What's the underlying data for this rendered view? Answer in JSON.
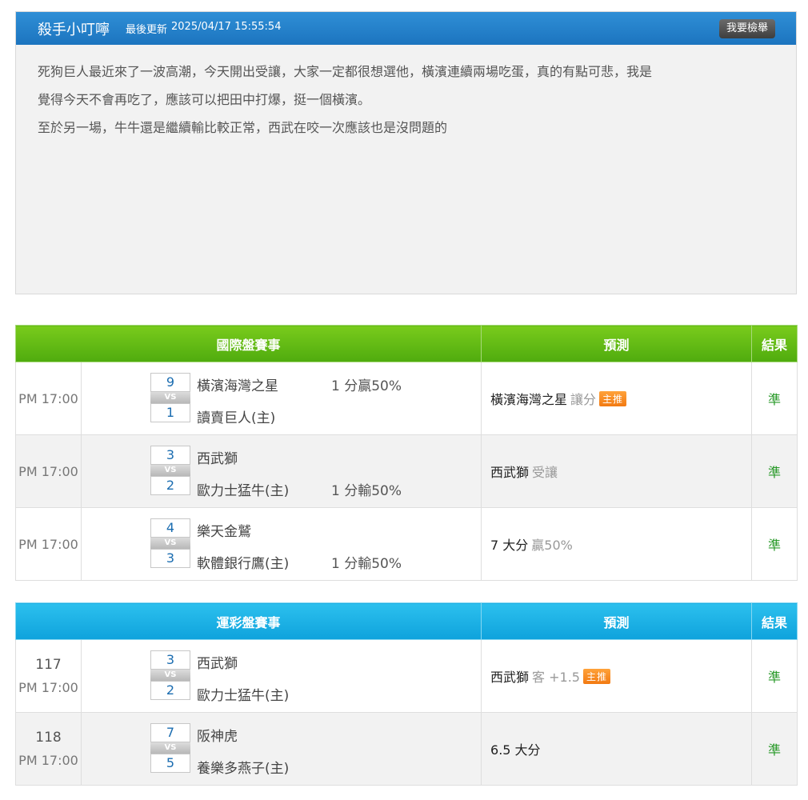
{
  "post": {
    "author": "殺手小叮嚀",
    "updated_label": "最後更新",
    "updated_time": "2025/04/17 15:55:54",
    "report_button": "我要檢舉",
    "body_lines": [
      "死狗巨人最近來了一波高潮，今天開出受讓，大家一定都很想選他，橫濱連續兩場吃蛋，真的有點可悲，我是",
      "覺得今天不會再吃了，應該可以把田中打爆，挺一個橫濱。",
      "至於另一場，牛牛還是繼續輸比較正常，西武在咬一次應該也是沒問題的"
    ]
  },
  "intl": {
    "header_match": "國際盤賽事",
    "header_pred": "預測",
    "header_result": "結果",
    "rows": [
      {
        "time": "PM 17:00",
        "score1": "9",
        "vs": "VS",
        "score2": "1",
        "team1": "橫濱海灣之星",
        "team2": "讀賣巨人(主)",
        "odds1": "1 分贏50%",
        "odds2": "",
        "pred_main": "橫濱海灣之星",
        "pred_extra": "讓分",
        "badge": "主推",
        "result": "準"
      },
      {
        "time": "PM 17:00",
        "score1": "3",
        "vs": "VS",
        "score2": "2",
        "team1": "西武獅",
        "team2": "歐力士猛牛(主)",
        "odds1": "",
        "odds2": "1 分輸50%",
        "pred_main": "西武獅",
        "pred_extra": "受讓",
        "badge": "",
        "result": "準"
      },
      {
        "time": "PM 17:00",
        "score1": "4",
        "vs": "VS",
        "score2": "3",
        "team1": "樂天金鷲",
        "team2": "軟體銀行鷹(主)",
        "odds1": "",
        "odds2": "1 分輸50%",
        "pred_main": "7 大分",
        "pred_extra": "贏50%",
        "badge": "",
        "result": "準"
      }
    ]
  },
  "sports": {
    "header_match": "運彩盤賽事",
    "header_pred": "預測",
    "header_result": "結果",
    "rows": [
      {
        "num": "117",
        "time": "PM 17:00",
        "score1": "3",
        "vs": "VS",
        "score2": "2",
        "team1": "西武獅",
        "team2": "歐力士猛牛(主)",
        "pred_main": "西武獅",
        "pred_extra": "客 +1.5",
        "badge": "主推",
        "result": "準"
      },
      {
        "num": "118",
        "time": "PM 17:00",
        "score1": "7",
        "vs": "VS",
        "score2": "5",
        "team1": "阪神虎",
        "team2": "養樂多燕子(主)",
        "pred_main": "6.5 大分",
        "pred_extra": "",
        "badge": "",
        "result": "準"
      }
    ]
  }
}
